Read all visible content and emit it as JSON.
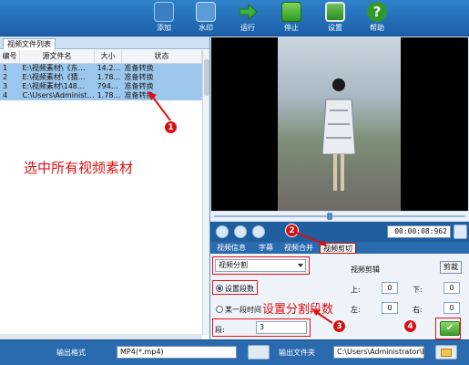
{
  "toolbar": {
    "add": "添加",
    "watermark": "水印",
    "run": "运行",
    "stop": "停止",
    "settings": "设置",
    "help": "帮助"
  },
  "file_list": {
    "tab": "视频文件列表",
    "columns": [
      "编号",
      "源文件名",
      "大小",
      "状态"
    ],
    "rows": [
      {
        "num": "1",
        "name": "E:\\视频素材\\《东…",
        "size": "14.2…",
        "status": "准备转换"
      },
      {
        "num": "2",
        "name": "E:\\视频素材\\《猜…",
        "size": "1.78…",
        "status": "准备转换"
      },
      {
        "num": "3",
        "name": "E:\\视频素材\\148…",
        "size": "794…",
        "status": "准备转换"
      },
      {
        "num": "4",
        "name": "C:\\Users\\Administ…",
        "size": "1.78…",
        "status": "准备转换"
      }
    ]
  },
  "annotations": {
    "select_all": "选中所有视频素材",
    "set_segments": "设置分割段数",
    "n1": "1",
    "n2": "2",
    "n3": "3",
    "n4": "4"
  },
  "player": {
    "time": "00:00:08:962"
  },
  "subtabs": [
    "视频信息",
    "字幕",
    "视频合并",
    "视频剪切"
  ],
  "clip": {
    "mode": "视频分割",
    "radio_segments": "设置段数",
    "radio_time": "某一段时间",
    "segments_label": "段:",
    "segments_value": "3",
    "crop_title": "视频剪辑",
    "crop_button": "剪裁",
    "top_label": "上:",
    "top_value": "0",
    "bottom_label": "下:",
    "bottom_value": "0",
    "left_label": "左:",
    "left_value": "0",
    "right_label": "右:",
    "right_value": "0"
  },
  "bottom": {
    "format_label": "输出格式",
    "format_value": "MP4(*.mp4)",
    "folder_label": "输出文件夹",
    "folder_value": "C:\\Users\\Administrator\\De"
  },
  "colors": {
    "accent": "#2a6aae",
    "annotation_red": "#e01010"
  }
}
